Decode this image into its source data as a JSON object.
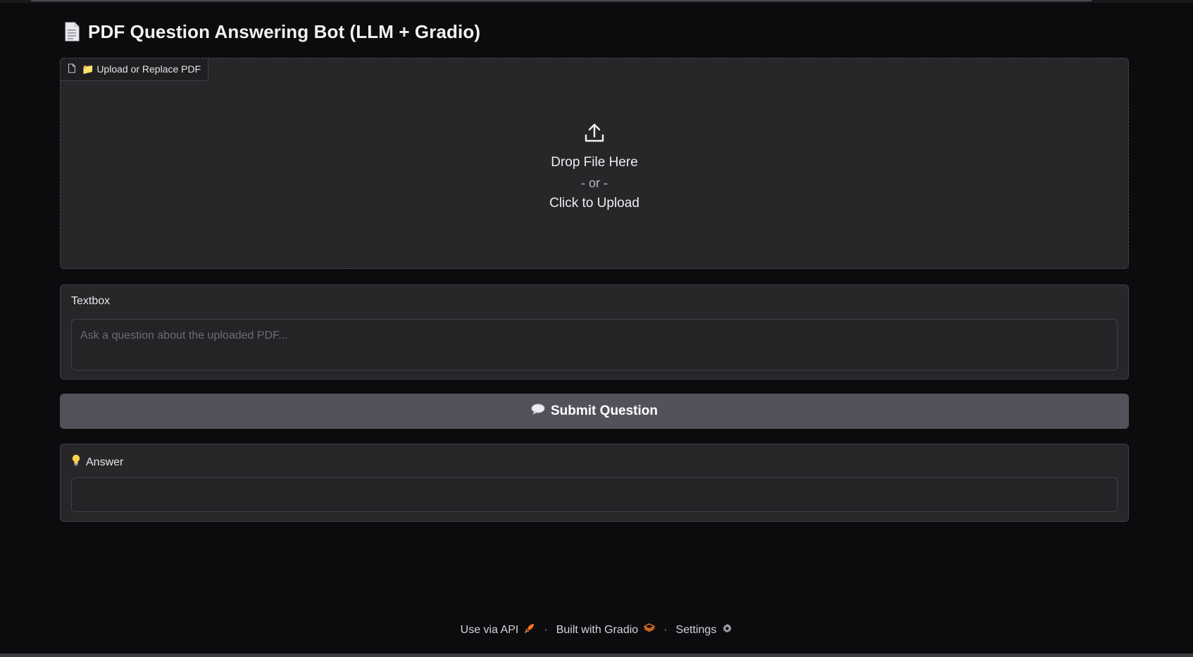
{
  "app": {
    "title": "PDF Question Answering Bot (LLM + Gradio)",
    "title_icon": "document-icon"
  },
  "upload": {
    "label": "📁 Upload or Replace PDF",
    "label_icon": "file-icon",
    "folder_icon": "folder-icon",
    "drop_text": "Drop File Here",
    "or_text": "- or -",
    "click_text": "Click to Upload",
    "upload_icon": "upload-icon"
  },
  "question": {
    "label": "Textbox",
    "value": "",
    "placeholder": "Ask a question about the uploaded PDF..."
  },
  "submit": {
    "label": "Submit Question",
    "icon": "speech-bubble-icon"
  },
  "answer": {
    "label": "Answer",
    "icon": "lightbulb-icon",
    "value": ""
  },
  "footer": {
    "api_label": "Use via API",
    "api_icon": "rocket-icon",
    "separator": "·",
    "built_label": "Built with Gradio",
    "gradio_icon": "gradio-logo-icon",
    "settings_label": "Settings",
    "settings_icon": "gear-icon"
  },
  "colors": {
    "background": "#0c0c0f",
    "panel": "#27272a",
    "button": "#52525b",
    "accent_orange": "#f97316"
  }
}
